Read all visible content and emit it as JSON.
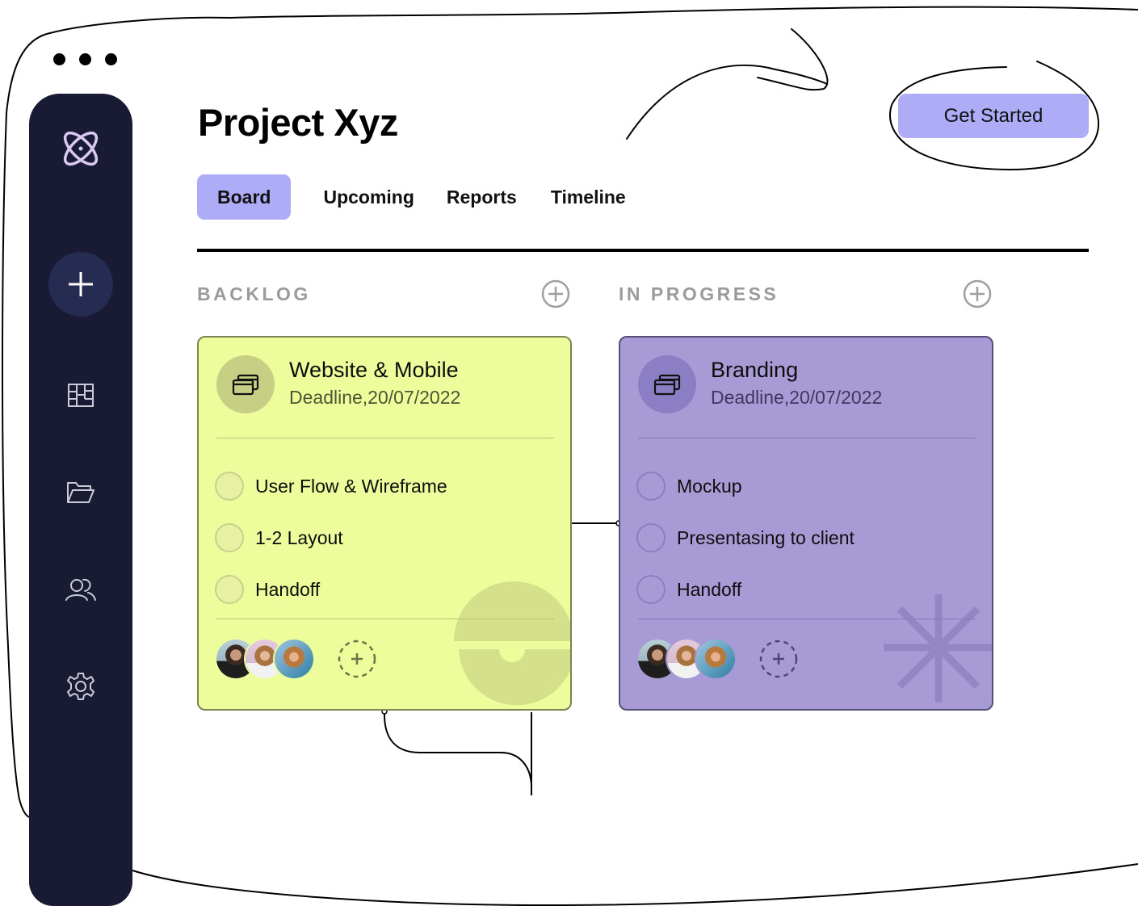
{
  "window": {
    "controls": [
      "dot",
      "dot",
      "dot"
    ]
  },
  "sidebar": {
    "items": [
      {
        "name": "logo",
        "icon": "atom-icon"
      },
      {
        "name": "add",
        "icon": "plus-icon"
      },
      {
        "name": "board",
        "icon": "board-layout-icon"
      },
      {
        "name": "projects",
        "icon": "folder-open-icon"
      },
      {
        "name": "team",
        "icon": "users-icon"
      },
      {
        "name": "settings",
        "icon": "gear-icon"
      }
    ]
  },
  "header": {
    "title": "Project Xyz",
    "cta_label": "Get Started"
  },
  "tabs": [
    {
      "label": "Board",
      "active": true
    },
    {
      "label": "Upcoming",
      "active": false
    },
    {
      "label": "Reports",
      "active": false
    },
    {
      "label": "Timeline",
      "active": false
    }
  ],
  "columns": [
    {
      "title": "BACKLOG",
      "card": {
        "title": "Website & Mobile",
        "deadline": "Deadline,20/07/2022",
        "color": "#eefd9b",
        "tasks": [
          "User Flow & Wireframe",
          "1-2 Layout",
          "Handoff"
        ],
        "members": 3
      }
    },
    {
      "title": "IN PROGRESS",
      "card": {
        "title": "Branding",
        "deadline": "Deadline,20/07/2022",
        "color": "#a89bd5",
        "tasks": [
          "Mockup",
          "Presentasing to client",
          "Handoff"
        ],
        "members": 3
      }
    }
  ],
  "colors": {
    "sidebar": "#181b33",
    "accent": "#aeabf7",
    "backlog_card": "#eefd9b",
    "progress_card": "#a89bd5"
  }
}
